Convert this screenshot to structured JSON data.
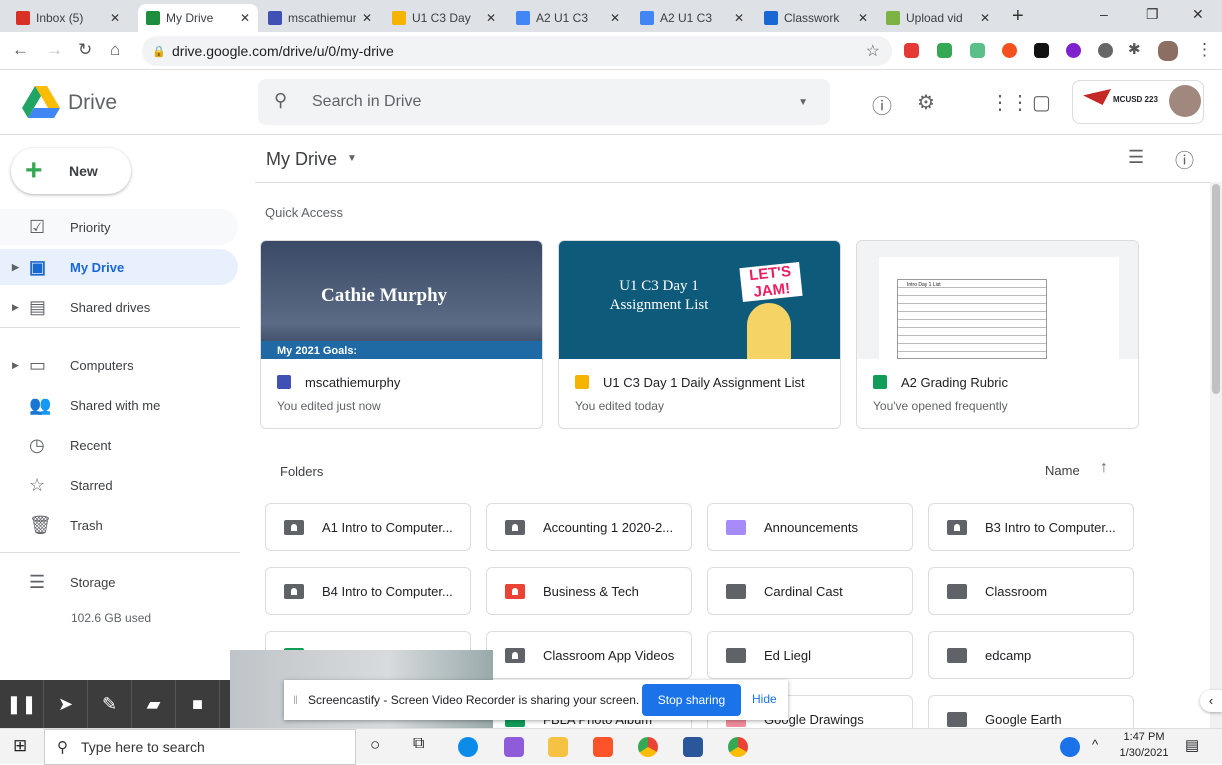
{
  "browser": {
    "tabs": [
      {
        "title": "Inbox (5)",
        "color": "#d93025"
      },
      {
        "title": "My Drive",
        "color": "#1e8e3e",
        "active": true
      },
      {
        "title": "mscathiemurphy",
        "color": "#3f51b5"
      },
      {
        "title": "U1 C3 Day",
        "color": "#f4b400"
      },
      {
        "title": "A2 U1 C3",
        "color": "#4285f4"
      },
      {
        "title": "A2 U1 C3",
        "color": "#4285f4"
      },
      {
        "title": "Classwork",
        "color": "#1967d2"
      },
      {
        "title": "Upload vid",
        "color": "#7cb342"
      }
    ],
    "new_tab": "+",
    "url": "drive.google.com/drive/u/0/my-drive"
  },
  "app": {
    "name": "Drive",
    "search_placeholder": "Search in Drive",
    "org_badge": "MCUSD 223"
  },
  "sidebar": {
    "new_label": "New",
    "items": [
      {
        "label": "Priority",
        "icon": "priority-icon"
      },
      {
        "label": "My Drive",
        "icon": "drive-icon",
        "selected": true
      },
      {
        "label": "Shared drives",
        "icon": "shared-drives-icon"
      },
      {
        "label": "Computers",
        "icon": "computer-icon"
      },
      {
        "label": "Shared with me",
        "icon": "people-icon"
      },
      {
        "label": "Recent",
        "icon": "clock-icon"
      },
      {
        "label": "Starred",
        "icon": "star-icon"
      },
      {
        "label": "Trash",
        "icon": "trash-icon"
      },
      {
        "label": "Storage",
        "icon": "storage-icon"
      }
    ],
    "storage_used": "102.6 GB used"
  },
  "main": {
    "title": "My Drive",
    "quick_access_label": "Quick Access",
    "quick_access": [
      {
        "name": "mscathiemurphy",
        "sub": "You edited just now",
        "thumb_title": "Cathie Murphy",
        "thumb_goals": "My 2021 Goals:",
        "icon_color": "#3f51b5"
      },
      {
        "name": "U1 C3 Day 1 Daily Assignment List",
        "sub": "You edited today",
        "thumb_title": "U1 C3 Day 1 Assignment List",
        "thumb_badge": "LET'S JAM!",
        "icon_color": "#f4b400"
      },
      {
        "name": "A2 Grading Rubric",
        "sub": "You've opened frequently",
        "thumb_title": "Intro Day 1 List",
        "icon_color": "#0f9d58"
      }
    ],
    "folders_label": "Folders",
    "sort_label": "Name",
    "folders": [
      {
        "name": "A1 Intro to Computer...",
        "shared": true,
        "color": "#5f6368"
      },
      {
        "name": "Accounting 1 2020-2...",
        "shared": true,
        "color": "#5f6368"
      },
      {
        "name": "Announcements",
        "shared": false,
        "color": "#a78bfa"
      },
      {
        "name": "B3 Intro to Computer...",
        "shared": true,
        "color": "#5f6368"
      },
      {
        "name": "B4 Intro to Computer...",
        "shared": true,
        "color": "#5f6368"
      },
      {
        "name": "Business & Tech",
        "shared": true,
        "color": "#ea4335"
      },
      {
        "name": "Cardinal Cast",
        "shared": false,
        "color": "#5f6368"
      },
      {
        "name": "Classroom",
        "shared": false,
        "color": "#5f6368"
      },
      {
        "name": "",
        "shared": false,
        "color": "#0f9d58"
      },
      {
        "name": "Classroom App Videos",
        "shared": true,
        "color": "#5f6368"
      },
      {
        "name": "Ed Liegl",
        "shared": false,
        "color": "#5f6368"
      },
      {
        "name": "edcamp",
        "shared": false,
        "color": "#5f6368"
      },
      {
        "name": "",
        "shared": false,
        "color": "#5f6368"
      },
      {
        "name": "FBLA Photo Album",
        "shared": false,
        "color": "#0f9d58"
      },
      {
        "name": "Google Drawings",
        "shared": false,
        "color": "#f28b9c"
      },
      {
        "name": "Google Earth",
        "shared": false,
        "color": "#5f6368"
      }
    ]
  },
  "screencastify": {
    "message": "Screencastify - Screen Video Recorder is sharing your screen.",
    "stop": "Stop sharing",
    "hide": "Hide"
  },
  "taskbar": {
    "search_placeholder": "Type here to search",
    "time": "1:47 PM",
    "date": "1/30/2021"
  }
}
